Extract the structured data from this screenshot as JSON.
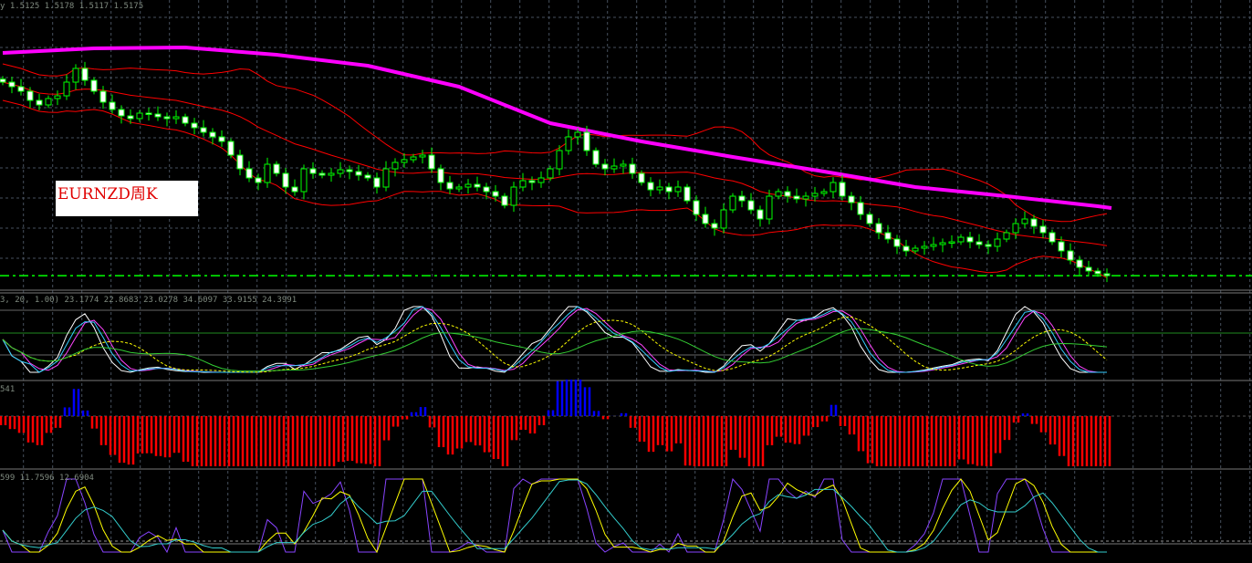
{
  "symbol_label": "EURNZD周K",
  "main_header": "y 1.5125 1.5178 1.5117 1.5175",
  "osc_header": "3, 20, 1.00) 23.1774 22.8683 23.0278 34.6097 33.9155 24.3991",
  "hist_header": "541",
  "lower_header": "599 11.7596 12.6904",
  "colors": {
    "candle_outline": "#00ff00",
    "bands": "#ff0000",
    "ma": "#ff00ff",
    "price_line": "#00ff00",
    "hist_pos": "#0000ff",
    "hist_neg": "#ff0000",
    "grid": "#46505e"
  },
  "chart_data": {
    "type": "candlestick",
    "title": "EURNZD周K",
    "timeframe": "weekly",
    "current_price": 1.5175,
    "ohlc_last": {
      "open": 1.5125,
      "high": 1.5178,
      "low": 1.5117,
      "close": 1.5175
    },
    "closes": [
      1.772,
      1.766,
      1.76,
      1.748,
      1.742,
      1.7504,
      1.754,
      1.772,
      1.79,
      1.7744,
      1.76,
      1.7456,
      1.736,
      1.7276,
      1.724,
      1.7312,
      1.73,
      1.7264,
      1.724,
      1.7264,
      1.718,
      1.712,
      1.706,
      1.7,
      1.694,
      1.676,
      1.658,
      1.646,
      1.64,
      1.664,
      1.652,
      1.634,
      1.628,
      1.658,
      1.652,
      1.6496,
      1.652,
      1.6568,
      1.6544,
      1.6496,
      1.646,
      1.634,
      1.658,
      1.6664,
      1.67,
      1.6736,
      1.676,
      1.658,
      1.64,
      1.6316,
      1.634,
      1.6376,
      1.634,
      1.628,
      1.622,
      1.61,
      1.634,
      1.6424,
      1.64,
      1.646,
      1.658,
      1.682,
      1.7,
      1.706,
      1.682,
      1.664,
      1.658,
      1.6616,
      1.664,
      1.652,
      1.64,
      1.6304,
      1.634,
      1.628,
      1.634,
      1.616,
      1.598,
      1.586,
      1.58,
      1.604,
      1.622,
      1.616,
      1.604,
      1.592,
      1.622,
      1.628,
      1.622,
      1.6184,
      1.622,
      1.6256,
      1.628,
      1.64,
      1.622,
      1.6136,
      1.598,
      1.586,
      1.574,
      1.5656,
      1.556,
      1.55,
      1.5536,
      1.556,
      1.5584,
      1.5608,
      1.562,
      1.568,
      1.562,
      1.5584,
      1.556,
      1.5656,
      1.574,
      1.586,
      1.592,
      1.5824,
      1.574,
      1.562,
      1.55,
      1.538,
      1.5284,
      1.5236,
      1.52,
      1.5175
    ],
    "ma_long": {
      "every_n_bars": 10,
      "values": [
        1.8104,
        1.8164,
        1.8176,
        1.808,
        1.7936,
        1.766,
        1.718,
        1.694,
        1.6736,
        1.6544,
        1.634,
        1.622,
        1.6088
      ]
    },
    "indicators": [
      "Bollinger Bands (20,2)",
      "Long moving average",
      "Stochastic-type oscillator",
      "Histogram (close vs MA)",
      "Lower oscillator"
    ]
  }
}
